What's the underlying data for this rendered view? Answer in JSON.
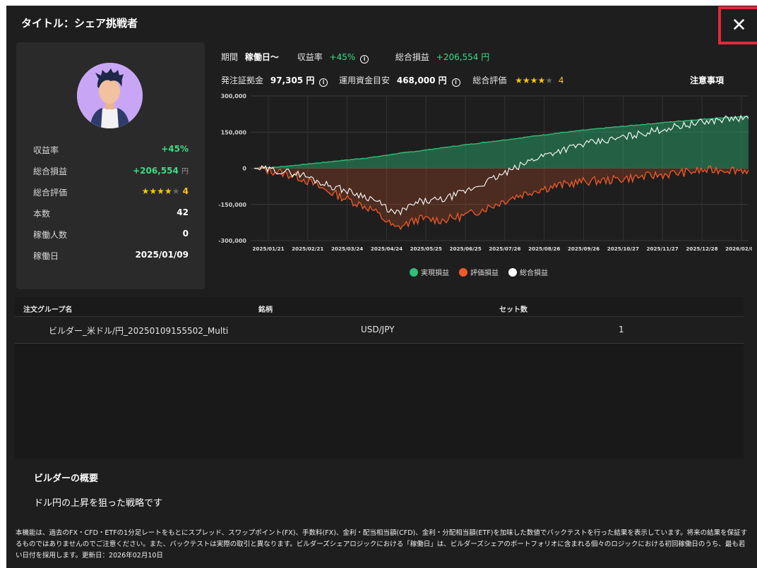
{
  "modal": {
    "title": "タイトル：シェア挑戦者",
    "close_icon": "close-icon"
  },
  "profile": {
    "avatar_icon": "avatar",
    "stats": [
      {
        "label": "収益率",
        "value": "+45%"
      },
      {
        "label": "総合損益",
        "value": "+206,554",
        "unit": "円"
      },
      {
        "label": "総合評価",
        "stars_filled": 4,
        "stars_total": 5,
        "value": "4"
      },
      {
        "label": "本数",
        "value": "42"
      },
      {
        "label": "稼働人数",
        "value": "0"
      },
      {
        "label": "稼働日",
        "value": "2025/01/09"
      }
    ]
  },
  "metrics": {
    "period_label": "期間",
    "period_value": "稼働日〜",
    "return_label": "収益率",
    "return_value": "+45%",
    "pnl_label": "総合損益",
    "pnl_value": "+206,554 円",
    "margin_label": "発注証拠金",
    "margin_value": "97,305 円",
    "capital_label": "運用資金目安",
    "capital_value": "468,000 円",
    "rating_label": "総合評価",
    "rating_value": "4",
    "rating_stars": 4,
    "notes_link": "注意事項"
  },
  "colors": {
    "green": "#3ddc84",
    "realized": "#2ebf7a",
    "unrealized": "#f05a28",
    "total": "#ffffff",
    "star": "#f5c518",
    "close_border": "#e0293b"
  },
  "chart_data": {
    "type": "area",
    "y_ticks": [
      "300,000",
      "150,000",
      "0",
      "-150,000",
      "-300,000"
    ],
    "ylim": [
      -300000,
      300000
    ],
    "x_ticks": [
      "2025/01/21",
      "2025/02/21",
      "2025/03/24",
      "2025/04/24",
      "2025/05/25",
      "2025/06/25",
      "2025/07/26",
      "2025/08/26",
      "2025/09/26",
      "2025/10/27",
      "2025/11/27",
      "2025/12/28",
      "2026/02/09"
    ],
    "grid": true,
    "legend_position": "bottom",
    "series": [
      {
        "name": "実現損益",
        "color": "#2ebf7a",
        "values": [
          0,
          5000,
          15000,
          25000,
          35000,
          45000,
          60000,
          72000,
          85000,
          98000,
          110000,
          122000,
          135000,
          147000,
          158000,
          168000,
          177000,
          186000,
          195000,
          203000,
          210000,
          214000
        ]
      },
      {
        "name": "評価損益",
        "color": "#f05a28",
        "values": [
          0,
          -15000,
          -40000,
          -90000,
          -130000,
          -170000,
          -250000,
          -210000,
          -215000,
          -195000,
          -160000,
          -120000,
          -90000,
          -70000,
          -55000,
          -50000,
          -40000,
          -30000,
          -20000,
          -10000,
          -5000,
          -8000
        ]
      },
      {
        "name": "総合損益",
        "color": "#ffffff",
        "values": [
          0,
          -10000,
          -25000,
          -65000,
          -95000,
          -125000,
          -190000,
          -140000,
          -130000,
          -95000,
          -50000,
          -5000,
          45000,
          75000,
          100000,
          115000,
          135000,
          155000,
          175000,
          190000,
          205000,
          206554
        ]
      }
    ]
  },
  "table": {
    "headers": [
      "注文グループ名",
      "銘柄",
      "セット数"
    ],
    "rows": [
      {
        "name": "ビルダー_米ドル/円_20250109155502_Multi",
        "symbol": "USD/JPY",
        "sets": "1"
      }
    ]
  },
  "summary": {
    "heading": "ビルダーの概要",
    "description": "ドル円の上昇を狙った戦略です"
  },
  "disclaimer": "本機能は、過去のFX・CFD・ETFの1分足レートをもとにスプレッド、スワップポイント(FX)、手数料(FX)、金利・配当相当額(CFD)、金利・分配相当額(ETF)を加味した数値でバックテストを行った結果を表示しています。将来の結果を保証するものではありませんのでご注意ください。また、バックテストは実際の取引と異なります。ビルダーズシェアロジックにおける「稼働日」は、ビルダーズシェアのポートフォリオに含まれる個々のロジックにおける初回稼働日のうち、最も若い日付を採用します。更新日：2026年02月10日"
}
